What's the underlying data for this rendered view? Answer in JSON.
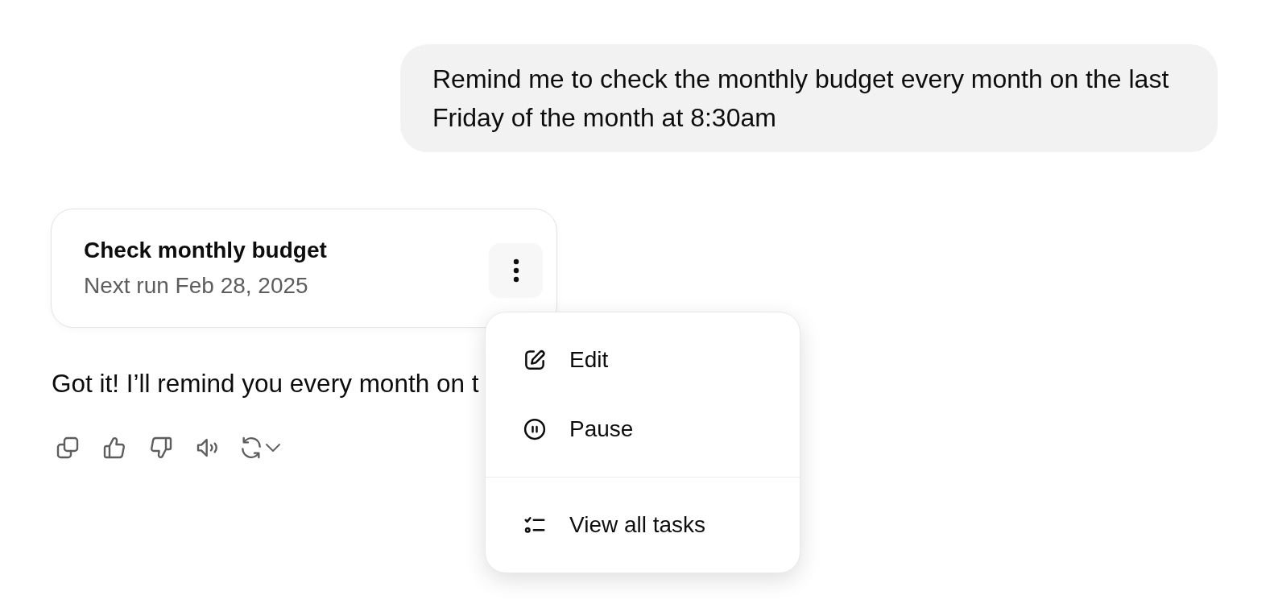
{
  "user_message": {
    "text": "Remind me to check the monthly budget every month on the last Friday of the month at 8:30am"
  },
  "task_card": {
    "title": "Check monthly budget",
    "subtitle": "Next run Feb 28, 2025",
    "menu_expanded": true
  },
  "task_menu": {
    "sections": [
      {
        "items": [
          {
            "kind": "edit",
            "label": "Edit"
          },
          {
            "kind": "pause",
            "label": "Pause"
          }
        ]
      },
      {
        "items": [
          {
            "kind": "tasks",
            "label": "View all tasks"
          }
        ]
      }
    ]
  },
  "assistant_message": {
    "text": "Got it! I’ll remind you every month on t"
  }
}
